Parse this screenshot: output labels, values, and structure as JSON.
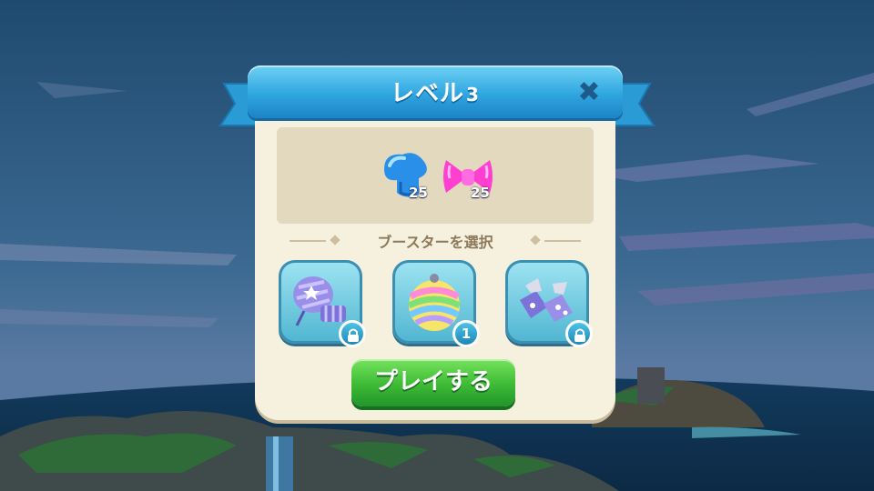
{
  "dialog": {
    "title": "レベル",
    "level_number": "3",
    "goals": [
      {
        "icon": "blue-candy-icon",
        "count": "25"
      },
      {
        "icon": "pink-bow-candy-icon",
        "count": "25"
      }
    ],
    "section_label": "ブースターを選択",
    "boosters": [
      {
        "icon": "striped-candy-booster-icon",
        "status": "locked"
      },
      {
        "icon": "rainbow-ball-booster-icon",
        "badge": "1"
      },
      {
        "icon": "wrapped-candy-booster-icon",
        "status": "locked"
      }
    ],
    "play_label": "プレイする"
  },
  "colors": {
    "ribbon": "#2fa6e0",
    "panel": "#f6f0df",
    "play_button": "#3dba35",
    "sky": "#1f3f63"
  }
}
